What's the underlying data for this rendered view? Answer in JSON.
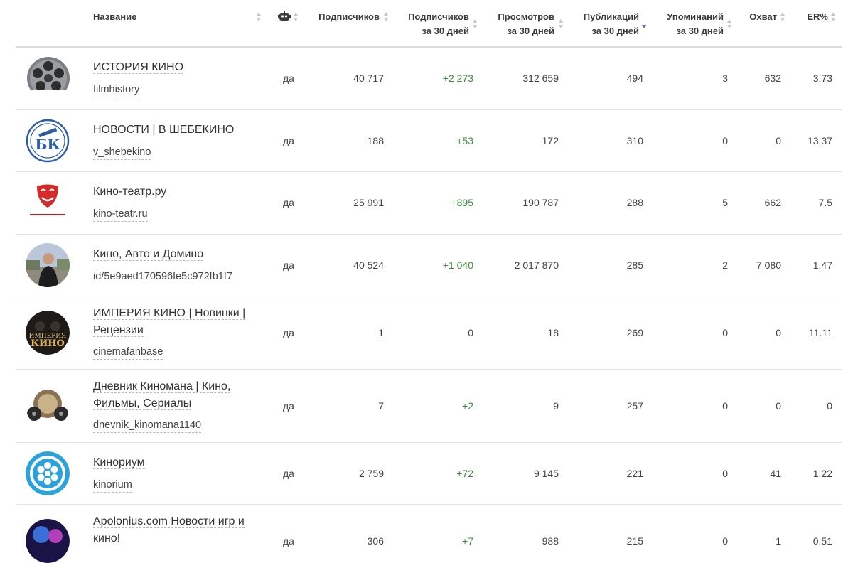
{
  "header": {
    "name": "Название",
    "bot_icon": "robot-icon",
    "subs": "Подписчиков",
    "subs30_l1": "Подписчиков",
    "subs30_l2": "за 30 дней",
    "views_l1": "Просмотров",
    "views_l2": "за 30 дней",
    "pubs_l1": "Публикаций",
    "pubs_l2": "за 30 дней",
    "mentions_l1": "Упоминаний",
    "mentions_l2": "за 30 дней",
    "reach": "Охват",
    "er": "ER%"
  },
  "sort_active": "pubs",
  "colors": {
    "accent_sort": "#6a6fb8",
    "positive": "#3b8a3b"
  },
  "rows": [
    {
      "name": "ИСТОРИЯ КИНО",
      "handle": "filmhistory",
      "bot": "да",
      "subs": "40 717",
      "subs30": "+2 273",
      "views": "312 659",
      "pubs": "494",
      "mentions": "3",
      "reach": "632",
      "er": "3.73",
      "avatar": "film-reel-avatar"
    },
    {
      "name": "НОВОСТИ | В ШЕБЕКИНО",
      "handle": "v_shebekino",
      "bot": "да",
      "subs": "188",
      "subs30": "+53",
      "views": "172",
      "pubs": "310",
      "mentions": "0",
      "reach": "0",
      "er": "13.37",
      "avatar": "bk-logo-avatar"
    },
    {
      "name": "Кино-театр.ру",
      "handle": "kino-teatr.ru",
      "bot": "да",
      "subs": "25 991",
      "subs30": "+895",
      "views": "190 787",
      "pubs": "288",
      "mentions": "5",
      "reach": "662",
      "er": "7.5",
      "avatar": "kino-teatr-logo-avatar"
    },
    {
      "name": "Кино, Авто и Домино",
      "handle": "id/5e9aed170596fe5c972fb1f7",
      "bot": "да",
      "subs": "40 524",
      "subs30": "+1 040",
      "views": "2 017 870",
      "pubs": "285",
      "mentions": "2",
      "reach": "7 080",
      "er": "1.47",
      "avatar": "person-photo-avatar"
    },
    {
      "name_l1": "ИМПЕРИЯ КИНО | Новинки |",
      "name_l2": "Рецензии",
      "handle": "cinemafanbase",
      "bot": "да",
      "subs": "1",
      "subs30": "0",
      "views": "18",
      "pubs": "269",
      "mentions": "0",
      "reach": "0",
      "er": "11.11",
      "avatar": "imperia-kino-avatar",
      "avatar_text_1": "ИМПЕРИЯ",
      "avatar_text_2": "КИНО"
    },
    {
      "name_l1": "Дневник Киномана | Кино,",
      "name_l2": "Фильмы, Сериалы",
      "handle": "dnevnik_kinomana1140",
      "bot": "да",
      "subs": "7",
      "subs30": "+2",
      "views": "9",
      "pubs": "257",
      "mentions": "0",
      "reach": "0",
      "er": "0",
      "avatar": "film-diary-avatar"
    },
    {
      "name": "Кинориум",
      "handle": "kinorium",
      "bot": "да",
      "subs": "2 759",
      "subs30": "+72",
      "views": "9 145",
      "pubs": "221",
      "mentions": "0",
      "reach": "41",
      "er": "1.22",
      "avatar": "kinorium-reel-avatar"
    },
    {
      "name_l1": "Apolonius.com Новости игр и",
      "name_l2": "кино!",
      "bot": "да",
      "subs": "306",
      "subs30": "+7",
      "views": "988",
      "pubs": "215",
      "mentions": "0",
      "reach": "1",
      "er": "0.51",
      "avatar": "apolonius-avatar"
    }
  ]
}
